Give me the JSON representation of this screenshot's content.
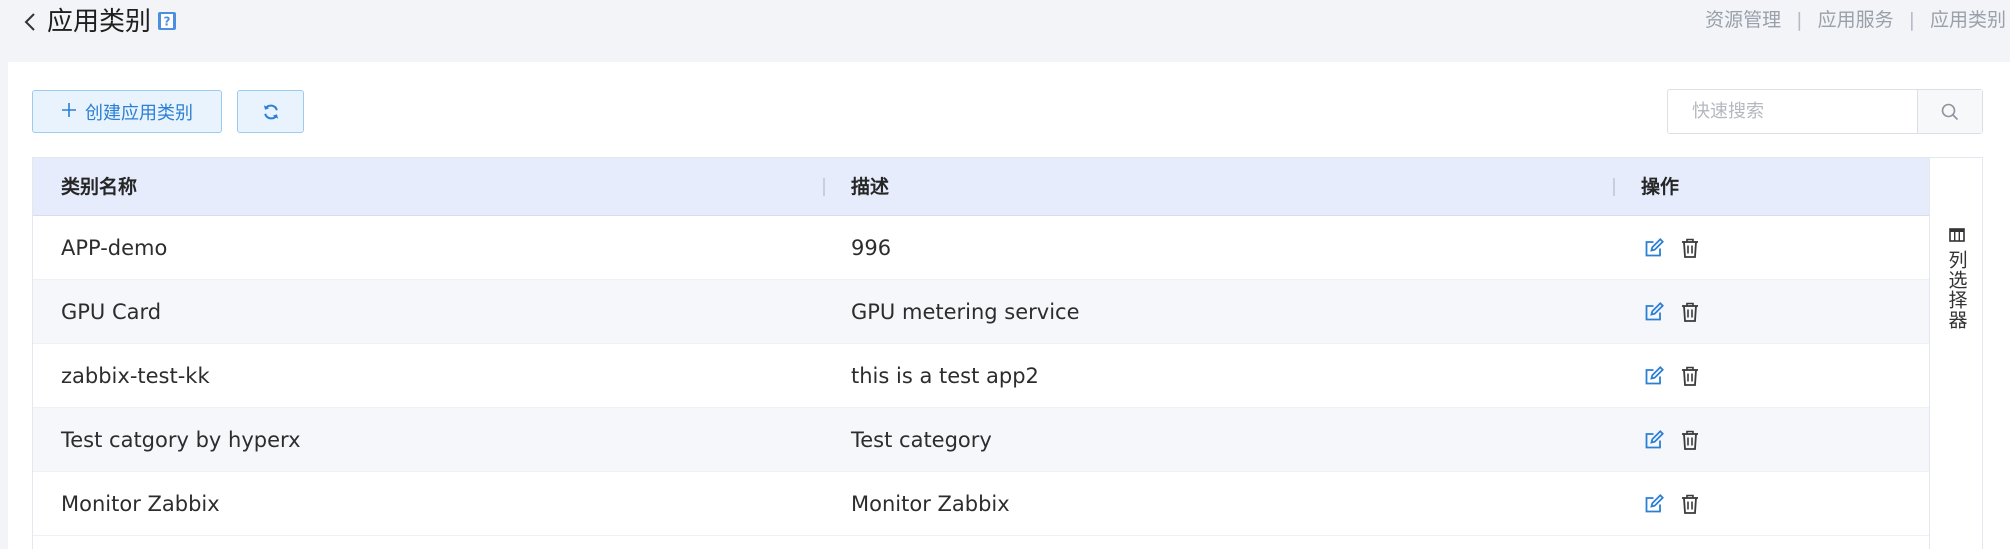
{
  "header": {
    "title": "应用类别",
    "back_icon": "chevron-left-icon",
    "help_icon": "help-book-icon",
    "breadcrumb": [
      "资源管理",
      "应用服务",
      "应用类别"
    ],
    "breadcrumb_separator": "|"
  },
  "toolbar": {
    "create_label": "创建应用类别",
    "create_icon": "plus-icon",
    "refresh_icon": "refresh-icon",
    "search_placeholder": "快速搜索",
    "search_icon": "search-icon"
  },
  "table": {
    "columns": [
      "类别名称",
      "描述",
      "操作"
    ],
    "rows": [
      {
        "name": "APP-demo",
        "description": "996"
      },
      {
        "name": "GPU Card",
        "description": "GPU metering service"
      },
      {
        "name": "zabbix-test-kk",
        "description": "this is a test app2"
      },
      {
        "name": "Test catgory by hyperx",
        "description": "Test category"
      },
      {
        "name": "Monitor Zabbix",
        "description": "Monitor Zabbix"
      }
    ],
    "row_actions": [
      "edit-icon",
      "delete-icon"
    ]
  },
  "column_selector": {
    "label": "列选择器",
    "icon": "columns-icon"
  },
  "colors": {
    "accent": "#2b7fd4",
    "header_bg": "#e6ecfb",
    "button_bg": "#e8f3fd",
    "button_border": "#9ecaf0",
    "page_bg": "#f3f4f8"
  }
}
